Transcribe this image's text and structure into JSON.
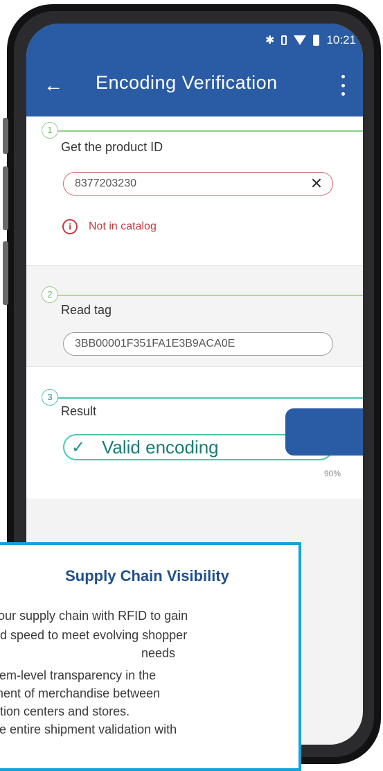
{
  "status_bar": {
    "bluetooth_icon": "bluetooth-icon",
    "vibrate_icon": "vibrate-icon",
    "wifi_icon": "wifi-icon",
    "battery_icon": "battery-icon",
    "time": "10:21"
  },
  "app_bar": {
    "back_glyph": "←",
    "title": "Encoding Verification",
    "menu_icon": "overflow-menu-icon"
  },
  "steps": [
    {
      "number": "1",
      "label": "Get the product ID",
      "input_value": "8377203230",
      "clear_glyph": "✕",
      "error_glyph": "i",
      "error_message": "Not in catalog"
    },
    {
      "number": "2",
      "label": "Read tag",
      "input_value": "3BB00001F351FA1E3B9ACA0E"
    },
    {
      "number": "3",
      "label": "Result",
      "check_glyph": "✓",
      "result_text": "Valid encoding"
    }
  ],
  "footer": {
    "battery_percent": "90%"
  },
  "info_panel": {
    "title": "Supply Chain Visibility",
    "lines": [
      "your supply chain with RFID to gain",
      "nd speed to meet evolving shopper",
      "needs",
      "item-level transparency in the",
      "ment of merchandise between",
      "ution centers and stores.",
      "ve entire shipment validation with"
    ]
  },
  "colors": {
    "app_bar": "#2a5ba5",
    "error": "#c23a3e",
    "step_1_accent": "#8ed08a",
    "step_2_accent": "#b7d98c",
    "step_3_accent": "#4cc6ae",
    "panel_border": "#13a3d6",
    "panel_title": "#1f4f8b"
  }
}
